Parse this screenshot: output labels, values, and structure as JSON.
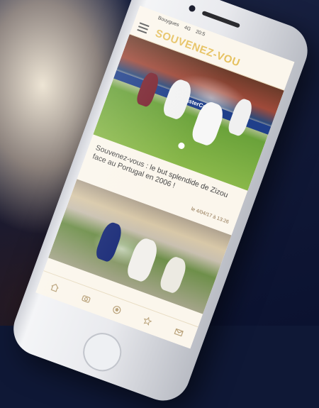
{
  "status_bar": {
    "carrier": "Bouygues",
    "network": "4G",
    "time": "20:5"
  },
  "app": {
    "title": "SOUVENEZ-VOU"
  },
  "article": {
    "headline": "Souvenez-vous : le but splendide de Zizou face au Portugal en 2006 !",
    "timestamp": "le 4/04/17 à 13:26"
  },
  "hero_ad_text": "MasterCard",
  "tabbar": {
    "icons": [
      "home-icon",
      "camera-icon",
      "ball-icon",
      "star-icon",
      "mail-icon"
    ]
  },
  "colors": {
    "accent": "#e6c15f",
    "screen_bg": "#fbf6ec"
  }
}
